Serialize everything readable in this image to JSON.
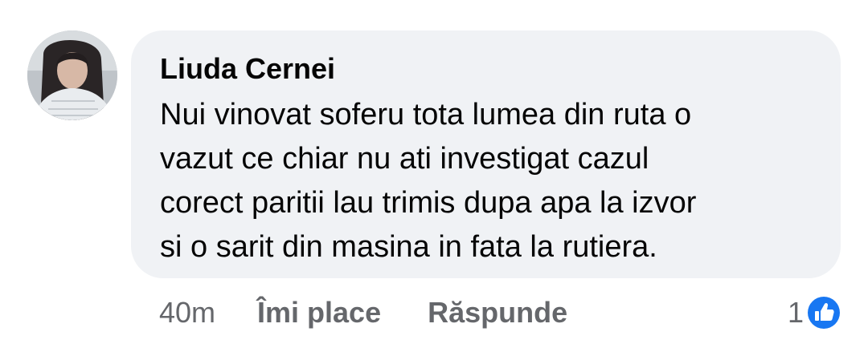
{
  "comment": {
    "author": "Liuda Cernei",
    "text_lines": [
      "Nui vinovat soferu tota lumea din ruta o",
      "vazut ce chiar nu ati investigat cazul",
      "corect paritii lau trimis dupa apa la izvor",
      "si o sarit din masina in fata la rutiera."
    ],
    "timestamp": "40m",
    "like_label": "Îmi place",
    "reply_label": "Răspunde",
    "reaction_count": "1",
    "reaction_icon": "like-thumb-icon"
  },
  "colors": {
    "bubble_bg": "#f0f2f5",
    "text_primary": "#050505",
    "text_secondary": "#65676b",
    "like_blue": "#1877f2"
  }
}
